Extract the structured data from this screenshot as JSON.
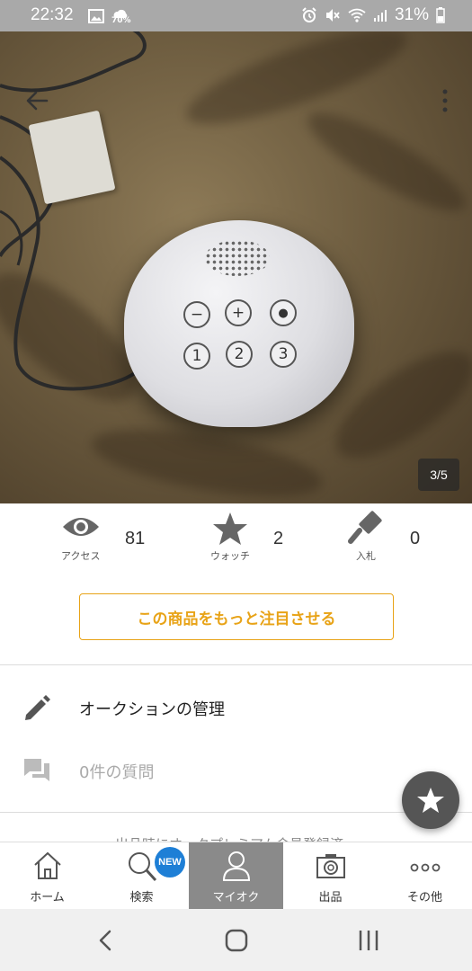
{
  "status_bar": {
    "time": "22:32",
    "weather_percent": "70%",
    "battery": "31%"
  },
  "photo": {
    "counter": "3/5",
    "icons": [
      "back-arrow-icon",
      "more-vert-icon"
    ]
  },
  "stats": {
    "access": {
      "label": "アクセス",
      "value": "81",
      "icon": "eye-icon"
    },
    "watch": {
      "label": "ウォッチ",
      "value": "2",
      "icon": "star-icon"
    },
    "bid": {
      "label": "入札",
      "value": "0",
      "icon": "gavel-icon"
    }
  },
  "promo_button": "この商品をもっと注目させる",
  "menu": {
    "manage": {
      "label": "オークションの管理",
      "icon": "pencil-icon"
    },
    "questions": {
      "label": "0件の質問",
      "icon": "chat-icon"
    }
  },
  "partial_text": "出品時にオークプレミアム会員登録済",
  "tabs": [
    {
      "label": "ホーム",
      "icon": "home-icon"
    },
    {
      "label": "検索",
      "icon": "search-icon",
      "badge": "NEW"
    },
    {
      "label": "マイオク",
      "icon": "person-icon",
      "active": true
    },
    {
      "label": "出品",
      "icon": "camera-icon"
    },
    {
      "label": "その他",
      "icon": "dots-icon"
    }
  ],
  "colors": {
    "accent": "#e8a317",
    "tab_active": "#8a8a8a",
    "badge": "#1e7fd6",
    "fab": "#555555"
  }
}
